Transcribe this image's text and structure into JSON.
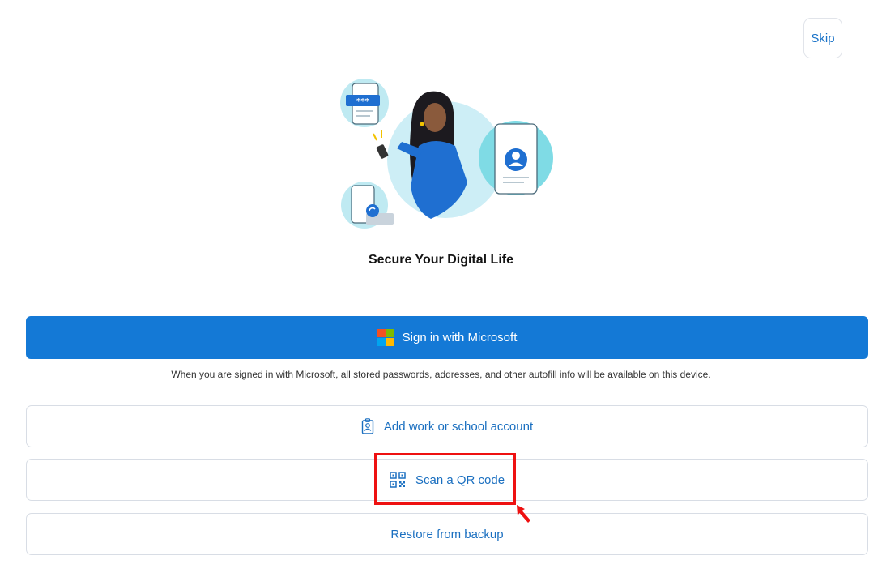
{
  "header": {
    "skip_label": "Skip"
  },
  "hero": {
    "title": "Secure Your Digital Life"
  },
  "primary": {
    "sign_in_label": "Sign in with Microsoft",
    "note": "When you are signed in with Microsoft, all stored passwords, addresses, and other autofill info will be available on this device."
  },
  "actions": {
    "work_label": "Add work or school account",
    "qr_label": "Scan a QR code",
    "restore_label": "Restore from backup"
  },
  "icons": {
    "ms_logo": "microsoft-logo-icon",
    "work": "id-badge-icon",
    "qr": "qr-code-icon",
    "cursor": "pointer-arrow-icon"
  },
  "colors": {
    "accent": "#1479d6",
    "link": "#1a6fc0",
    "highlight": "#ee1111",
    "ms_red": "#f25022",
    "ms_green": "#7fba00",
    "ms_blue": "#00a4ef",
    "ms_yellow": "#ffb900"
  }
}
